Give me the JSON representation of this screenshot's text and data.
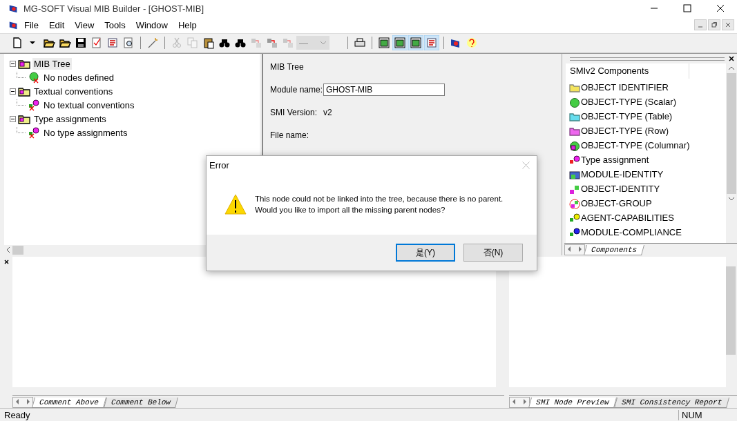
{
  "window": {
    "title": "MG-SOFT Visual MIB Builder - [GHOST-MIB]"
  },
  "menu": [
    "File",
    "Edit",
    "View",
    "Tools",
    "Window",
    "Help"
  ],
  "toolbar": [
    {
      "kind": "new",
      "disabled": false,
      "pressed": false
    },
    {
      "kind": "caret",
      "disabled": false,
      "pressed": false
    },
    {
      "kind": "open",
      "disabled": false,
      "pressed": false
    },
    {
      "kind": "open",
      "disabled": false,
      "pressed": false
    },
    {
      "kind": "save",
      "disabled": false,
      "pressed": false
    },
    {
      "kind": "check",
      "disabled": false,
      "pressed": false
    },
    {
      "kind": "list",
      "disabled": false,
      "pressed": false
    },
    {
      "kind": "find",
      "disabled": false,
      "pressed": false
    },
    {
      "kind": "sep"
    },
    {
      "kind": "wand",
      "disabled": false,
      "pressed": false
    },
    {
      "kind": "sep"
    },
    {
      "kind": "cut",
      "disabled": true,
      "pressed": false
    },
    {
      "kind": "copy",
      "disabled": true,
      "pressed": false
    },
    {
      "kind": "paste",
      "disabled": false,
      "pressed": false
    },
    {
      "kind": "binoculars",
      "disabled": false,
      "pressed": false
    },
    {
      "kind": "binoculars",
      "disabled": false,
      "pressed": false
    },
    {
      "kind": "node",
      "disabled": true,
      "pressed": false
    },
    {
      "kind": "node",
      "disabled": false,
      "pressed": false
    },
    {
      "kind": "node",
      "disabled": true,
      "pressed": false
    },
    {
      "kind": "combo",
      "value": "—",
      "disabled": true
    },
    {
      "kind": "sep"
    },
    {
      "kind": "print",
      "disabled": false,
      "pressed": false
    },
    {
      "kind": "sep"
    },
    {
      "kind": "window",
      "disabled": false,
      "pressed": false
    },
    {
      "kind": "window",
      "disabled": false,
      "pressed": true
    },
    {
      "kind": "window",
      "disabled": false,
      "pressed": true
    },
    {
      "kind": "list",
      "disabled": false,
      "pressed": true
    },
    {
      "kind": "sep"
    },
    {
      "kind": "logo",
      "disabled": false,
      "pressed": false
    },
    {
      "kind": "help",
      "disabled": false,
      "pressed": false
    }
  ],
  "tree": [
    {
      "label": "MIB Tree",
      "kind": "root",
      "selected": true,
      "expanded": true,
      "children": [
        {
          "label": "No nodes defined",
          "kind": "none",
          "selected": false
        }
      ]
    },
    {
      "label": "Textual conventions",
      "kind": "folder",
      "selected": false,
      "expanded": true,
      "children": [
        {
          "label": "No textual conventions",
          "kind": "empty",
          "selected": false
        }
      ]
    },
    {
      "label": "Type assignments",
      "kind": "folder",
      "selected": false,
      "expanded": true,
      "children": [
        {
          "label": "No type assignments",
          "kind": "empty",
          "selected": false
        }
      ]
    }
  ],
  "properties": {
    "heading": "MIB Tree",
    "fields": [
      {
        "label": "Module name:",
        "kind": "input",
        "value": "GHOST-MIB"
      },
      {
        "label": "SMI Version:",
        "kind": "text",
        "value": "v2"
      },
      {
        "label": "File name:",
        "kind": "text"
      }
    ]
  },
  "components": {
    "header": "SMIv2 Components",
    "items": [
      {
        "label": "OBJECT IDENTIFIER",
        "kind": "identifier"
      },
      {
        "label": "OBJECT-TYPE (Scalar)",
        "kind": "scalar"
      },
      {
        "label": "OBJECT-TYPE (Table)",
        "kind": "table"
      },
      {
        "label": "OBJECT-TYPE (Row)",
        "kind": "row"
      },
      {
        "label": "OBJECT-TYPE (Columnar)",
        "kind": "columnar"
      },
      {
        "label": "Type assignment",
        "kind": "type"
      },
      {
        "label": "MODULE-IDENTITY",
        "kind": "module"
      },
      {
        "label": "OBJECT-IDENTITY",
        "kind": "identity"
      },
      {
        "label": "OBJECT-GROUP",
        "kind": "group"
      },
      {
        "label": "AGENT-CAPABILITIES",
        "kind": "capabilities"
      },
      {
        "label": "MODULE-COMPLIANCE",
        "kind": "compliance"
      }
    ],
    "tabs": [
      {
        "label": "Components",
        "selected": true
      }
    ]
  },
  "bottom_left_tabs": [
    {
      "label": "Comment Above",
      "selected": true
    },
    {
      "label": "Comment Below",
      "selected": false
    }
  ],
  "bottom_right_tabs": [
    {
      "label": "SMI Node Preview",
      "selected": true
    },
    {
      "label": "SMI Consistency Report",
      "selected": false
    }
  ],
  "status_bar": {
    "message": "Ready",
    "indicator": "NUM"
  },
  "dialog": {
    "title": "Error",
    "message": "This node could not be linked into the tree, because there is no parent.\nWould you like to import all the missing parent nodes?",
    "buttons": [
      {
        "label": "是(Y)",
        "selected": true
      },
      {
        "label": "否(N)",
        "selected": false
      }
    ]
  }
}
